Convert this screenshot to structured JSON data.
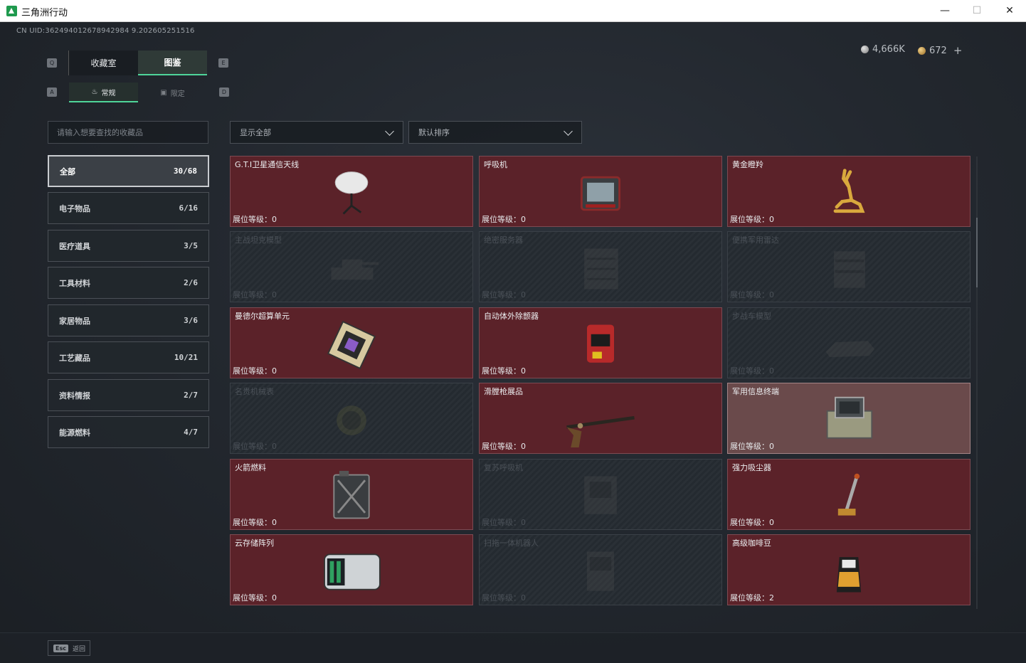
{
  "window": {
    "title": "三角洲行动",
    "minimize": "—",
    "maximize": "☐",
    "close": "✕"
  },
  "uid": "CN UID:362494012678942984 9.202605251516",
  "currency": {
    "silver": "4,666K",
    "gold": "672",
    "add": "+"
  },
  "key_hints": {
    "q": "Q",
    "e": "E",
    "a": "A",
    "d": "D"
  },
  "tabs": {
    "collection": "收藏室",
    "atlas": "图鉴",
    "normal": "常规",
    "limited": "限定"
  },
  "search": {
    "placeholder": "请输入想要查找的收藏品"
  },
  "filters": {
    "show": "显示全部",
    "sort": "默认排序"
  },
  "categories": [
    {
      "label": "全部",
      "count": "30/68"
    },
    {
      "label": "电子物品",
      "count": "6/16"
    },
    {
      "label": "医疗道具",
      "count": "3/5"
    },
    {
      "label": "工具材料",
      "count": "2/6"
    },
    {
      "label": "家居物品",
      "count": "3/6"
    },
    {
      "label": "工艺藏品",
      "count": "10/21"
    },
    {
      "label": "资料情报",
      "count": "2/7"
    },
    {
      "label": "能源燃料",
      "count": "4/7"
    }
  ],
  "level_label": "展位等级：",
  "items": [
    {
      "name": "G.T.I卫星通信天线",
      "level": "0",
      "owned": true,
      "icon": "satellite-dish-icon"
    },
    {
      "name": "呼吸机",
      "level": "0",
      "owned": true,
      "icon": "ventilator-icon"
    },
    {
      "name": "黄金瞪羚",
      "level": "0",
      "owned": true,
      "icon": "golden-gazelle-icon"
    },
    {
      "name": "主战坦克模型",
      "level": "0",
      "owned": false,
      "icon": "tank-model-icon"
    },
    {
      "name": "绝密服务器",
      "level": "0",
      "owned": false,
      "icon": "server-icon"
    },
    {
      "name": "便携军用雷达",
      "level": "0",
      "owned": false,
      "icon": "radar-icon"
    },
    {
      "name": "曼德尔超算单元",
      "level": "0",
      "owned": true,
      "icon": "cpu-unit-icon"
    },
    {
      "name": "自动体外除颤器",
      "level": "0",
      "owned": true,
      "icon": "defibrillator-icon"
    },
    {
      "name": "步战车模型",
      "level": "0",
      "owned": false,
      "icon": "ifv-model-icon"
    },
    {
      "name": "名贵机械表",
      "level": "0",
      "owned": false,
      "icon": "watch-icon"
    },
    {
      "name": "滑膛枪展品",
      "level": "0",
      "owned": true,
      "icon": "musket-icon"
    },
    {
      "name": "军用信息终端",
      "level": "0",
      "owned": true,
      "icon": "terminal-icon",
      "highlight": true
    },
    {
      "name": "火箭燃料",
      "level": "0",
      "owned": true,
      "icon": "fuel-can-icon"
    },
    {
      "name": "复苏呼吸机",
      "level": "0",
      "owned": false,
      "icon": "resuscitator-icon"
    },
    {
      "name": "强力吸尘器",
      "level": "0",
      "owned": true,
      "icon": "vacuum-icon"
    },
    {
      "name": "云存储阵列",
      "level": "0",
      "owned": true,
      "icon": "storage-array-icon"
    },
    {
      "name": "扫拖一体机器人",
      "level": "0",
      "owned": false,
      "icon": "robot-vacuum-icon"
    },
    {
      "name": "高级咖啡豆",
      "level": "2",
      "owned": true,
      "icon": "coffee-bag-icon"
    }
  ],
  "footer": {
    "esc_key": "Esc",
    "back": "返回"
  }
}
